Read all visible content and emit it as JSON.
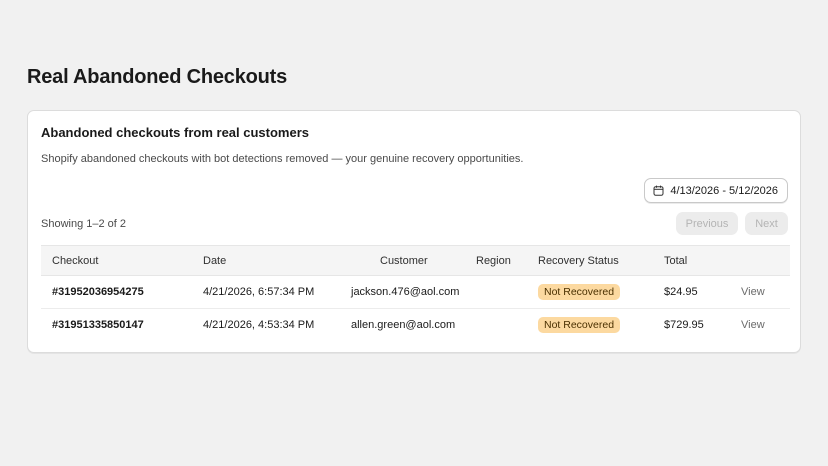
{
  "page": {
    "title": "Real Abandoned Checkouts"
  },
  "card": {
    "title": "Abandoned checkouts from real customers",
    "subtitle": "Shopify abandoned checkouts with bot detections removed — your genuine recovery opportunities.",
    "date_range": {
      "icon": "calendar-icon",
      "label": "4/13/2026 - 5/12/2026"
    },
    "showing": "Showing 1–2 of 2",
    "pagination": {
      "previous_label": "Previous",
      "next_label": "Next"
    }
  },
  "table": {
    "headers": {
      "checkout": "Checkout",
      "date": "Date",
      "customer": "Customer",
      "region": "Region",
      "status": "Recovery Status",
      "total": "Total"
    },
    "rows": [
      {
        "checkout": "#31952036954275",
        "date": "4/21/2026, 6:57:34 PM",
        "customer": "jackson.476@aol.com",
        "region": "",
        "status": "Not Recovered",
        "total": "$24.95",
        "action": "View"
      },
      {
        "checkout": "#31951335850147",
        "date": "4/21/2026, 4:53:34 PM",
        "customer": "allen.green@aol.com",
        "region": "",
        "status": "Not Recovered",
        "total": "$729.95",
        "action": "View"
      }
    ]
  },
  "colors": {
    "background": "#f1f1f1",
    "status_badge_bg": "#fcd9a0",
    "status_badge_text": "#4a3000",
    "disabled_button_bg": "#ececec",
    "disabled_button_text": "#b4b4b4"
  }
}
